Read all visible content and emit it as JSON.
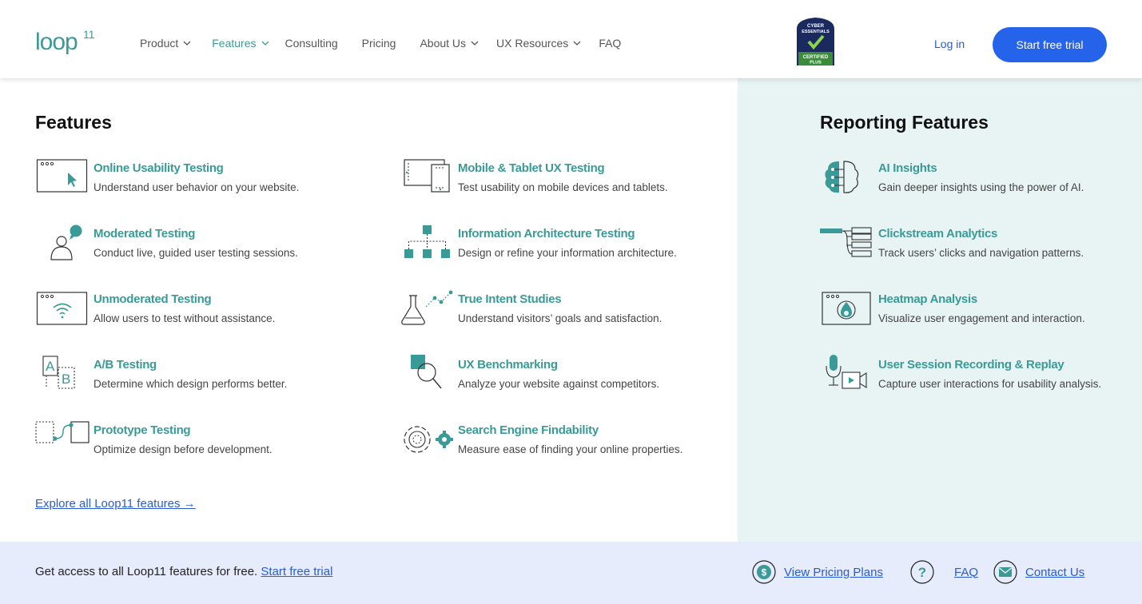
{
  "header": {
    "logo_text": "loop11",
    "nav": [
      {
        "label": "Product",
        "has_dropdown": true,
        "active": false
      },
      {
        "label": "Features",
        "has_dropdown": true,
        "active": true
      },
      {
        "label": "Consulting",
        "has_dropdown": false,
        "active": false
      },
      {
        "label": "Pricing",
        "has_dropdown": false,
        "active": false
      },
      {
        "label": "About Us",
        "has_dropdown": true,
        "active": false
      },
      {
        "label": "UX Resources",
        "has_dropdown": true,
        "active": false
      },
      {
        "label": "FAQ",
        "has_dropdown": false,
        "active": false
      }
    ],
    "badge_lines": [
      "CYBER",
      "ESSENTIALS",
      "CERTIFIED",
      "PLUS"
    ],
    "login_label": "Log in",
    "cta_label": "Start free trial"
  },
  "features": {
    "title": "Features",
    "items": [
      {
        "title": "Online Usability Testing",
        "desc": "Understand user behavior on your website.",
        "icon": "browser-cursor-icon"
      },
      {
        "title": "Moderated Testing",
        "desc": "Conduct live, guided user testing sessions.",
        "icon": "user-chat-icon"
      },
      {
        "title": "Unmoderated Testing",
        "desc": "Allow users to test without assistance.",
        "icon": "browser-wifi-icon"
      },
      {
        "title": "A/B Testing",
        "desc": "Determine which design performs better.",
        "icon": "ab-test-icon"
      },
      {
        "title": "Prototype Testing",
        "desc": "Optimize design before development.",
        "icon": "prototype-flow-icon"
      },
      {
        "title": "Mobile & Tablet UX Testing",
        "desc": " Test usability on mobile devices and tablets.",
        "icon": "mobile-tablet-icon"
      },
      {
        "title": "Information Architecture Testing",
        "desc": "Design or refine your information architecture.",
        "icon": "sitemap-icon"
      },
      {
        "title": "True Intent Studies",
        "desc": "Understand visitors’ goals and satisfaction.",
        "icon": "flask-trend-icon"
      },
      {
        "title": "UX Benchmarking",
        "desc": "Analyze your website against competitors.",
        "icon": "magnifier-benchmark-icon"
      },
      {
        "title": "Search Engine Findability",
        "desc": "Measure ease of finding your online properties.",
        "icon": "gears-icon"
      }
    ],
    "explore_link": "Explore all Loop11 features →"
  },
  "reporting": {
    "title": "Reporting Features",
    "items": [
      {
        "title": "AI Insights",
        "desc": "Gain deeper insights using the power of AI.",
        "icon": "ai-brain-icon"
      },
      {
        "title": "Clickstream Analytics",
        "desc": "Track users’ clicks and navigation patterns.",
        "icon": "clickstream-icon"
      },
      {
        "title": "Heatmap Analysis",
        "desc": "Visualize user engagement and interaction.",
        "icon": "heatmap-icon"
      },
      {
        "title": "User Session Recording & Replay",
        "desc": " Capture user interactions for usability analysis.",
        "icon": "mic-video-icon"
      }
    ]
  },
  "footer": {
    "promo_text": "Get access to all Loop11 features for free.",
    "promo_link": "Start free trial",
    "links": [
      {
        "label": "View Pricing Plans",
        "icon": "dollar-circle-icon"
      },
      {
        "label": "FAQ",
        "icon": "question-circle-icon"
      },
      {
        "label": "Contact Us",
        "icon": "envelope-circle-icon"
      }
    ]
  },
  "colors": {
    "accent_teal": "#3a9a97",
    "link_blue": "#2a5bd7",
    "cta_blue": "#2563eb",
    "side_bg": "#e8f4f3",
    "footer_bg": "#e6ecfb"
  }
}
